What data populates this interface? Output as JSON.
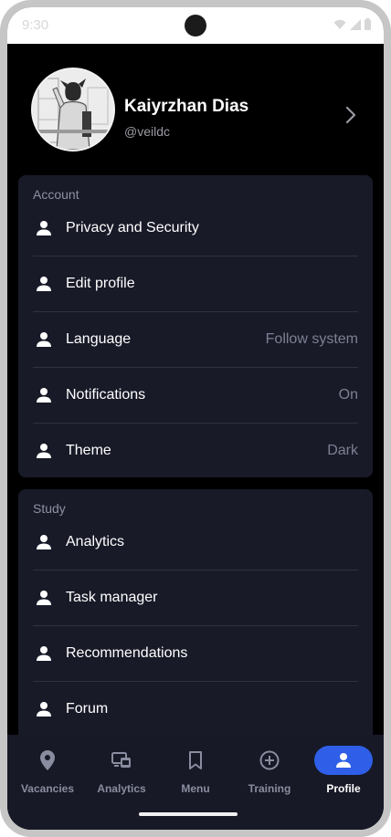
{
  "status_bar": {
    "time": "9:30"
  },
  "profile": {
    "name": "Kaiyrzhan Dias",
    "handle": "@veildc"
  },
  "sections": {
    "account": {
      "title": "Account",
      "items": [
        {
          "label": "Privacy and Security",
          "value": ""
        },
        {
          "label": "Edit profile",
          "value": ""
        },
        {
          "label": "Language",
          "value": "Follow system"
        },
        {
          "label": "Notifications",
          "value": "On"
        },
        {
          "label": "Theme",
          "value": "Dark"
        }
      ]
    },
    "study": {
      "title": "Study",
      "items": [
        {
          "label": "Analytics"
        },
        {
          "label": "Task manager"
        },
        {
          "label": "Recommendations"
        },
        {
          "label": "Forum"
        }
      ]
    }
  },
  "bottom_nav": {
    "items": [
      {
        "label": "Vacancies",
        "icon": "location-pin-icon"
      },
      {
        "label": "Analytics",
        "icon": "devices-icon"
      },
      {
        "label": "Menu",
        "icon": "bookmark-icon"
      },
      {
        "label": "Training",
        "icon": "add-circle-icon"
      },
      {
        "label": "Profile",
        "icon": "person-icon"
      }
    ],
    "active": "Profile"
  },
  "colors": {
    "background": "#000000",
    "card": "#181a28",
    "accent": "#2f5fe8",
    "muted_text": "#8d90a3"
  }
}
